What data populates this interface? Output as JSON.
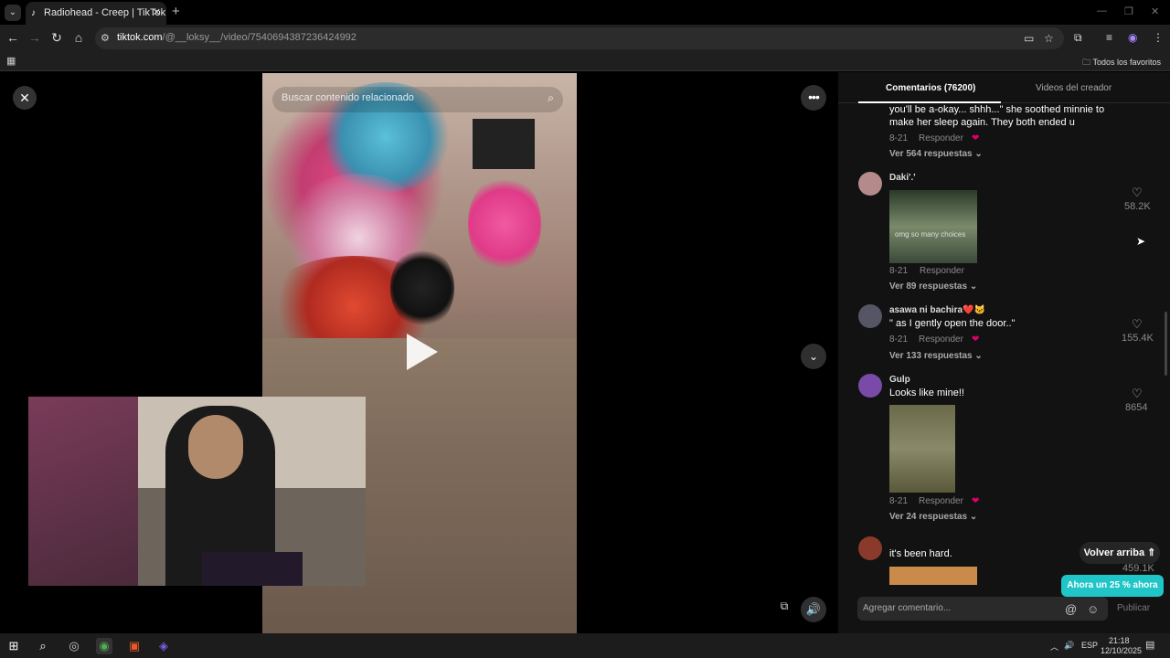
{
  "browser": {
    "tab_title": "Radiohead - Creep | TikTok",
    "url_host": "tiktok.com",
    "url_path": "/@__loksy__/video/7540694387236424992",
    "bookmarks_label": "Todos los favoritos"
  },
  "player": {
    "search_placeholder": "Buscar contenido relacionado"
  },
  "panel": {
    "tabs": [
      "Comentarios (76200)",
      "Videos del creador"
    ],
    "comments": [
      {
        "text": "you'll be a-okay... shhh...\" she soothed minnie to make her sleep again. They both ended u",
        "date": "8-21",
        "reply": "Responder",
        "more": "Ver 564 respuestas"
      },
      {
        "name": "Daki'.'",
        "image_caption": "omg so many choices",
        "date": "8-21",
        "reply": "Responder",
        "more": "Ver 89 respuestas",
        "likes": "58.2K"
      },
      {
        "name": "asawa ni bachira❤️🐱",
        "text": "\" as I gently open the door..\"",
        "date": "8-21",
        "reply": "Responder",
        "more": "Ver 133 respuestas",
        "likes": "155.4K"
      },
      {
        "name": "Gulp",
        "text": "Looks like mine!!",
        "date": "8-21",
        "reply": "Responder",
        "more": "Ver 24 respuestas",
        "likes": "8654"
      },
      {
        "text": "it's been hard.",
        "likes": "459.1K"
      }
    ],
    "back_to_top": "Volver arriba",
    "promo": "Ahora un 25 % ahora",
    "comment_placeholder": "Agregar comentario...",
    "publish": "Publicar"
  },
  "taskbar": {
    "lang": "ESP",
    "time": "21:18",
    "date": "12/10/2025"
  },
  "colors": {
    "accent": "#20c5c8",
    "panel_bg": "#121212"
  }
}
